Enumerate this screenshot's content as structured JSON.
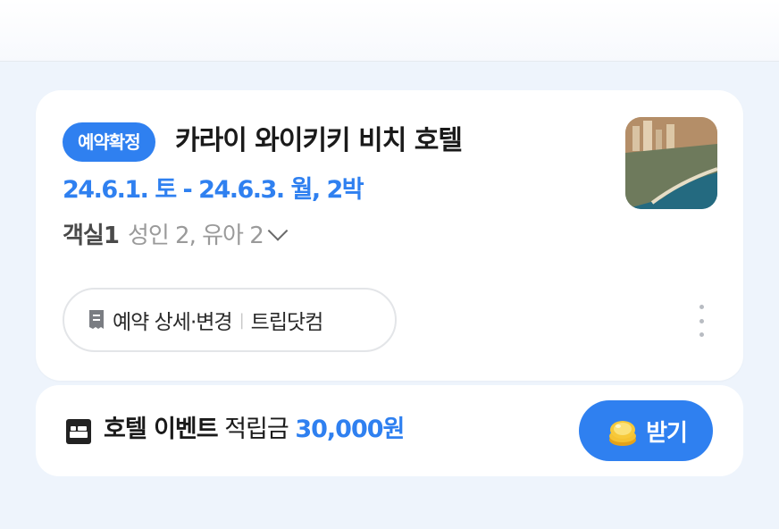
{
  "booking": {
    "status_badge": "예약확정",
    "hotel_name": "카라이 와이키키 비치 호텔",
    "dates": "24.6.1. 토 - 24.6.3. 월, 2박",
    "room_label": "객실1",
    "guests": "성인 2, 유아 2",
    "thumbnail_icon": "hotel-photo"
  },
  "actions": {
    "detail_label": "예약 상세·변경",
    "provider": "트립닷컴",
    "detail_icon": "document-icon",
    "more_icon": "kebab-menu-icon"
  },
  "event": {
    "title": "호텔 이벤트",
    "reward_label": "적립금",
    "amount": "30,000원",
    "receive_label": "받기",
    "icon": "bed-icon",
    "button_icon": "coin-icon"
  },
  "colors": {
    "accent": "#2f80f0",
    "background": "#eef4fc"
  }
}
